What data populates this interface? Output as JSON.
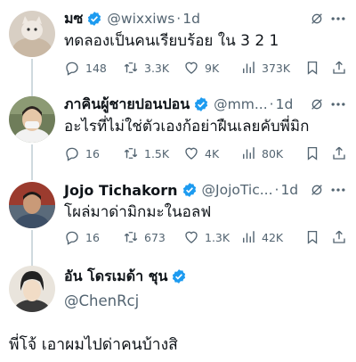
{
  "tweets": [
    {
      "name": "มซ",
      "handle": "@wixxiws",
      "dot": "·",
      "time": "1d",
      "text": "ทดลองเป็นคนเรียบร้อย ใน 3 2 1",
      "replies": "148",
      "reposts": "3.3K",
      "likes": "9K",
      "views": "373K"
    },
    {
      "name": "ภาคินผู้ชายปอนปอน",
      "handle": "@mm...",
      "dot": "·",
      "time": "1d",
      "text": "อะไรที่ไม่ใช่ตัวเองก้อย่าฝืนเลยคับพี่มิก",
      "replies": "16",
      "reposts": "1.5K",
      "likes": "4K",
      "views": "80K"
    },
    {
      "name": "Jojo Tichakorn",
      "handle": "@JojoTic...",
      "dot": "·",
      "time": "1d",
      "text": "โผล่มาด่ามิกมะในอลฟ",
      "replies": "16",
      "reposts": "673",
      "likes": "1.3K",
      "views": "42K"
    }
  ],
  "main_tweet": {
    "name": "อัน โดรเมด้า ชุน",
    "handle": "@ChenRcj",
    "text": "พี่โจ้ เอาผมไปด่าคนบ้างสิ"
  },
  "colors": {
    "verified": "#1d9bf0",
    "secondary_text": "#536471",
    "thread_line": "#cfd9de"
  },
  "icons": [
    "reply-icon",
    "repost-icon",
    "like-icon",
    "views-icon",
    "bookmark-icon",
    "share-icon",
    "grok-icon",
    "more-icon",
    "verified-badge-icon"
  ]
}
